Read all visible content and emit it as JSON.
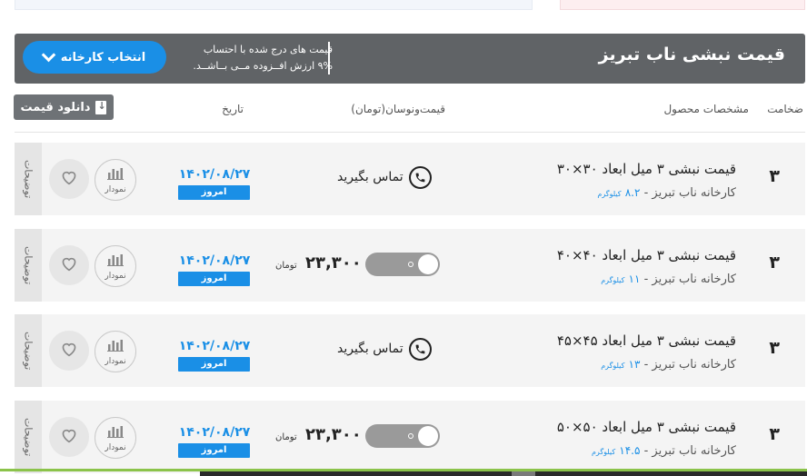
{
  "header": {
    "title": "قیمت نبشی ناب تبریز",
    "vat_line1": "قیمت های درج شده با احتساب",
    "vat_line2": "۹% ارزش افــزوده مــی بــاشــد.",
    "factory_button": "انتخاب کارخانه"
  },
  "columns": {
    "thickness": "ضخامت",
    "specs": "مشخصات محصول",
    "price": "قیمت‌ونوسان(تومان)",
    "date": "تاریخ",
    "download": "دانلود قیمت"
  },
  "row_labels": {
    "description": "توضیحات",
    "chart": "نمودار",
    "today": "امروز",
    "contact": "تماس بگیرید",
    "currency": "تومان",
    "kg": "کیلوگرم"
  },
  "rows": [
    {
      "name": "قیمت نبشی ۳ میل ابعاد ۳۰×۳۰",
      "factory": "کارخانه ناب تبریز - ",
      "weight": "۸.۲",
      "thickness": "۳",
      "date": "۱۴۰۲/۰۸/۲۷",
      "price": "",
      "has_price": false
    },
    {
      "name": "قیمت نبشی ۳ میل ابعاد ۴۰×۴۰",
      "factory": "کارخانه ناب تبریز - ",
      "weight": "۱۱",
      "thickness": "۳",
      "date": "۱۴۰۲/۰۸/۲۷",
      "price": "۲۳,۳۰۰",
      "has_price": true
    },
    {
      "name": "قیمت نبشی ۳ میل ابعاد ۴۵×۴۵",
      "factory": "کارخانه ناب تبریز - ",
      "weight": "۱۳",
      "thickness": "۳",
      "date": "۱۴۰۲/۰۸/۲۷",
      "price": "",
      "has_price": false
    },
    {
      "name": "قیمت نبشی ۳ میل ابعاد ۵۰×۵۰",
      "factory": "کارخانه ناب تبریز - ",
      "weight": "۱۴.۵",
      "thickness": "۳",
      "date": "۱۴۰۲/۰۸/۲۷",
      "price": "۲۳,۳۰۰",
      "has_price": true
    }
  ],
  "colors": {
    "accent": "#1a8fe6",
    "header_bg": "#606366",
    "row_bg": "#f4f4f4"
  },
  "icons": {
    "phone": "phone-icon",
    "heart": "heart-icon",
    "chart": "bar-chart-icon",
    "download": "download-icon",
    "chevron": "chevron-down-icon"
  }
}
